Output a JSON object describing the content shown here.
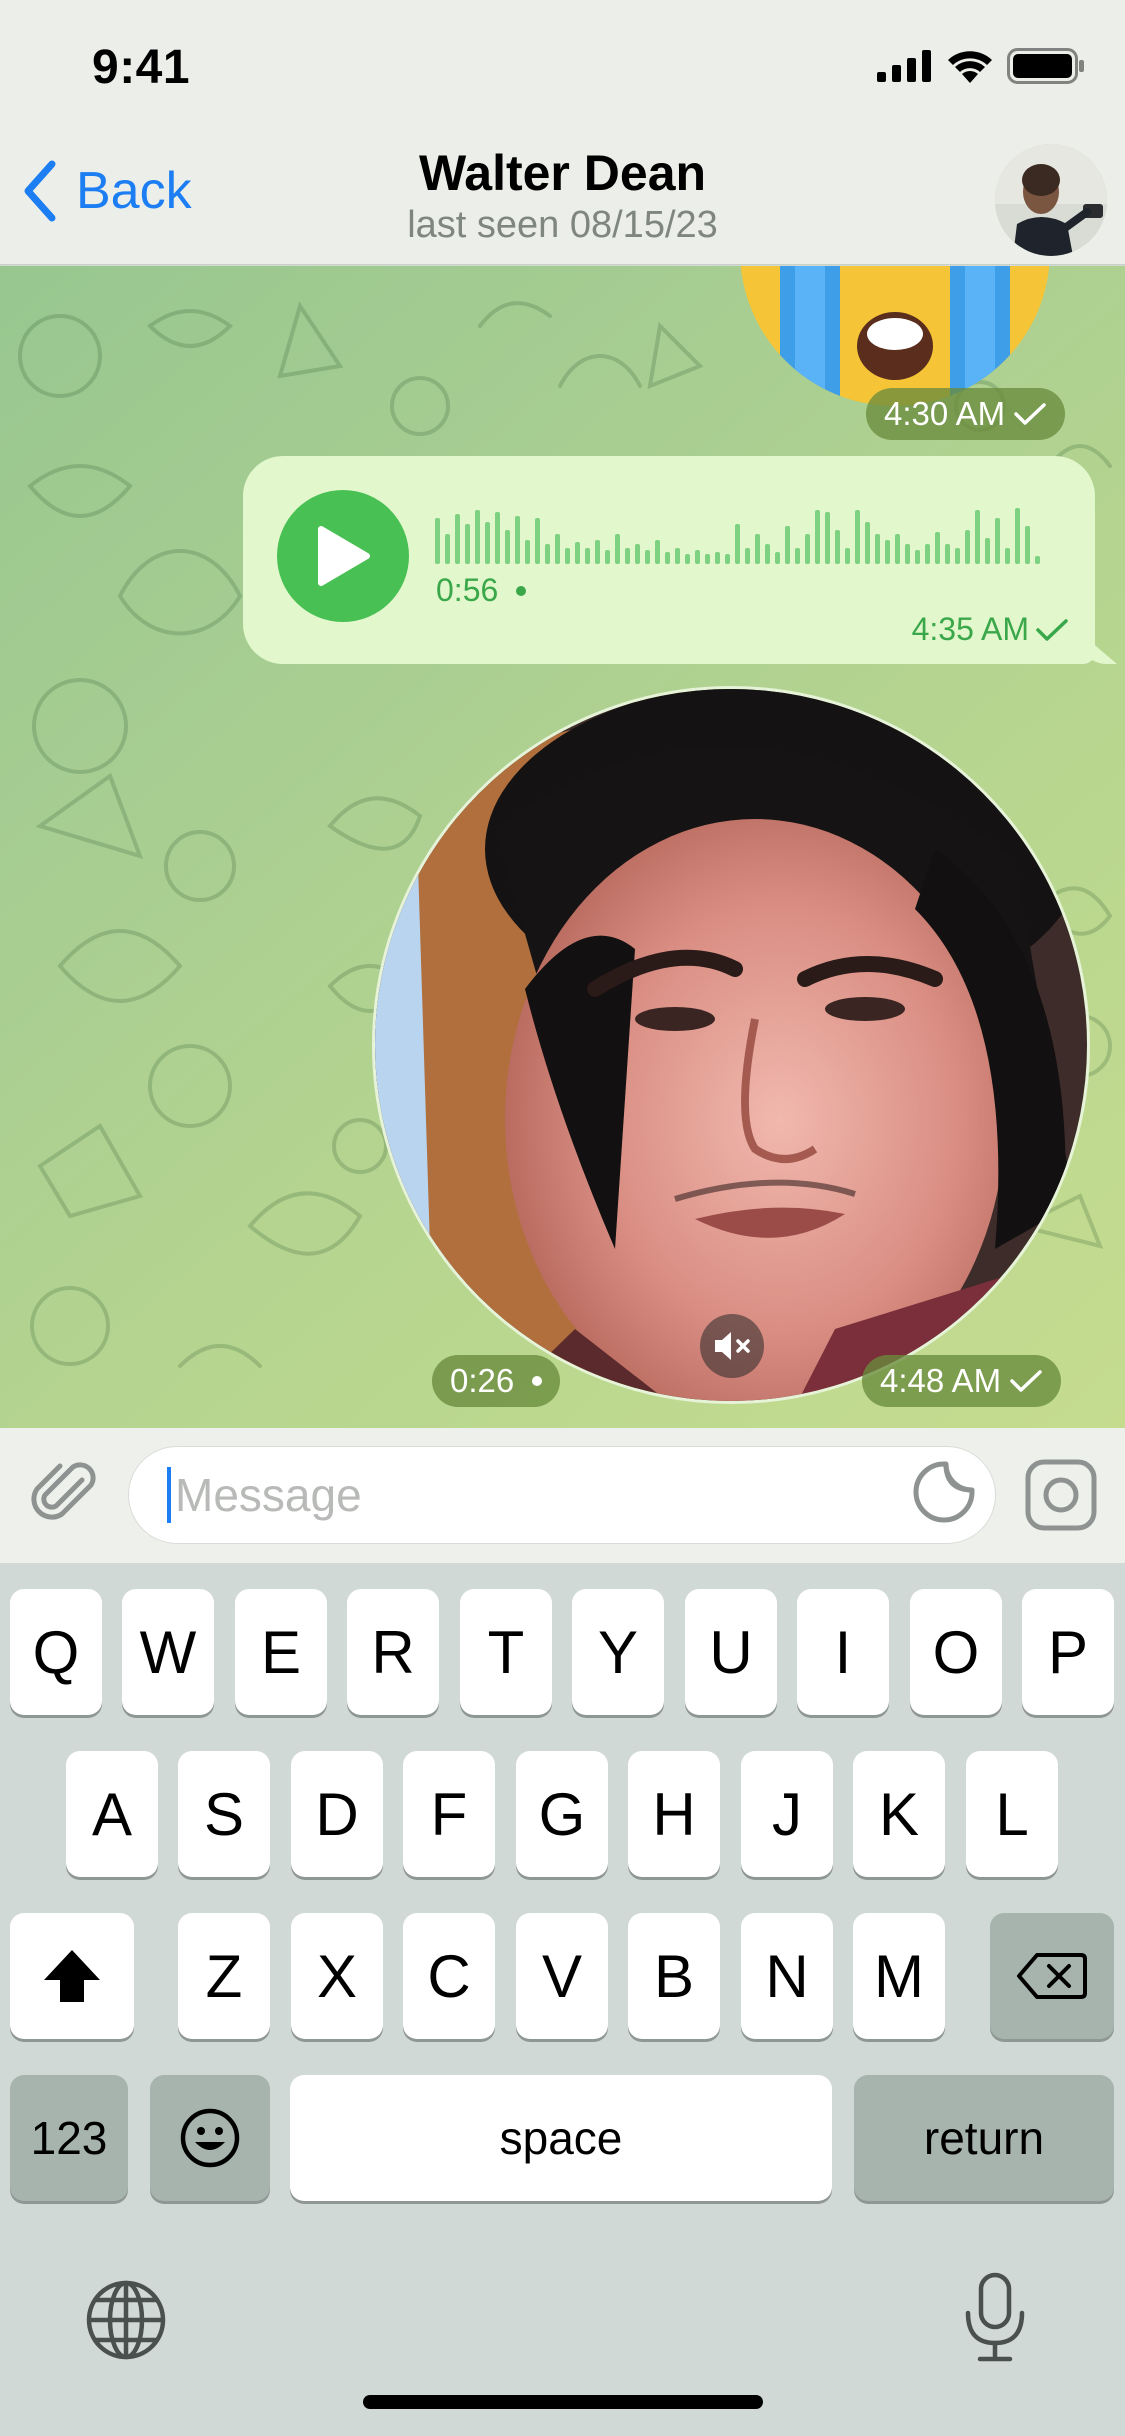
{
  "status_bar": {
    "time": "9:41"
  },
  "header": {
    "back_label": "Back",
    "contact_name": "Walter Dean",
    "contact_status": "last seen 08/15/23"
  },
  "messages": {
    "sticker": {
      "time": "4:30 AM"
    },
    "voice": {
      "duration": "0:56",
      "time": "4:35 AM"
    },
    "video": {
      "duration": "0:26",
      "time": "4:48 AM"
    }
  },
  "input": {
    "placeholder": "Message"
  },
  "keyboard": {
    "row1": [
      "Q",
      "W",
      "E",
      "R",
      "T",
      "Y",
      "U",
      "I",
      "O",
      "P"
    ],
    "row2": [
      "A",
      "S",
      "D",
      "F",
      "G",
      "H",
      "J",
      "K",
      "L"
    ],
    "row3": [
      "Z",
      "X",
      "C",
      "V",
      "B",
      "N",
      "M"
    ],
    "numbers_label": "123",
    "space_label": "space",
    "return_label": "return"
  },
  "colors": {
    "accent": "#1c7ef2",
    "bubble_out": "#e2f7cc",
    "voice_green": "#49c054",
    "chat_bg": "#a7cd92"
  },
  "icons": {
    "attach": "paperclip-icon",
    "sticker": "sticker-icon",
    "camera": "camera-icon",
    "mute": "speaker-muted-icon",
    "shift": "shift-icon",
    "backspace": "backspace-icon",
    "emoji": "emoji-icon",
    "globe": "globe-icon",
    "mic": "microphone-icon"
  }
}
